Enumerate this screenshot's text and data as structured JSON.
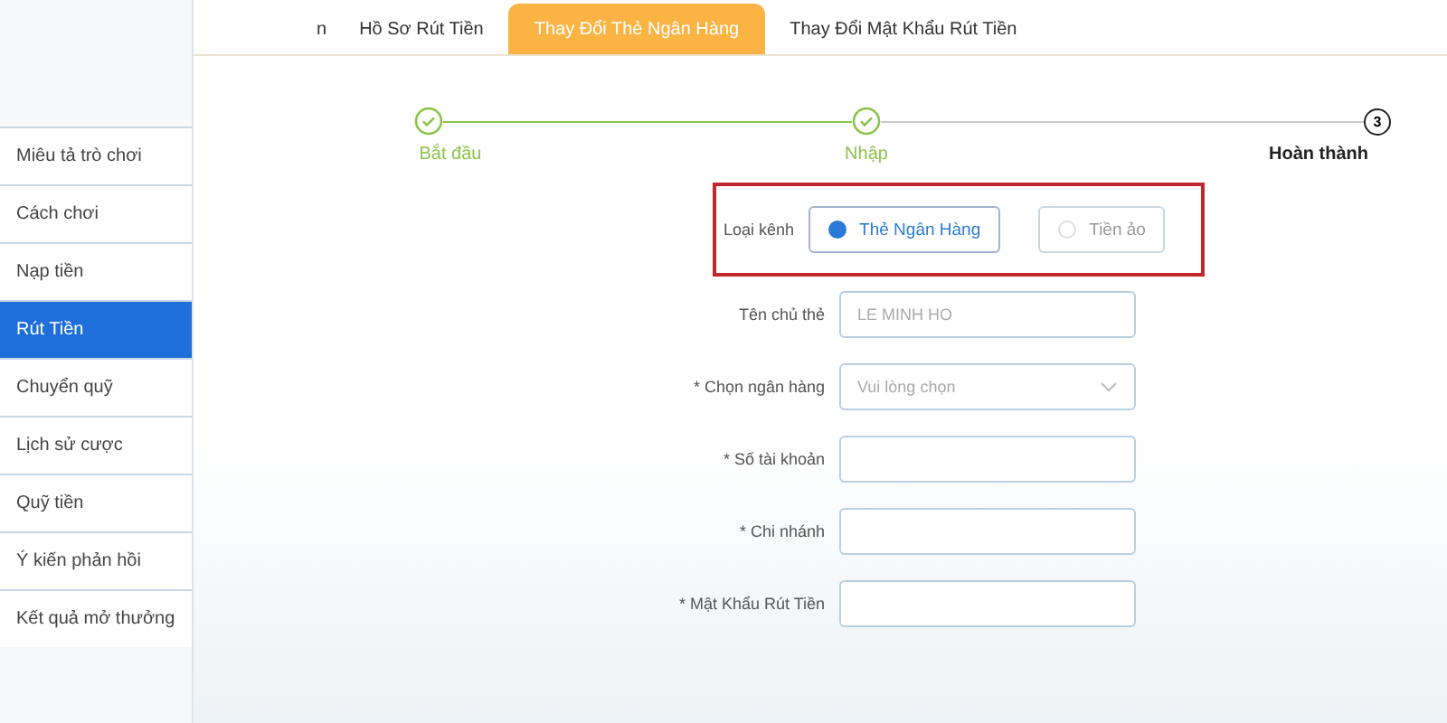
{
  "tabs": [
    {
      "label": "n",
      "selected": false
    },
    {
      "label": "Hồ Sơ Rút Tiền",
      "selected": false
    },
    {
      "label": "Thay Đổi Thẻ Ngân Hàng",
      "selected": true
    },
    {
      "label": "Thay Đổi Mật Khẩu Rút Tiền",
      "selected": false
    }
  ],
  "sidebar": {
    "items": [
      {
        "label": "Miêu tả trò chơi",
        "selected": false
      },
      {
        "label": "Cách chơi",
        "selected": false
      },
      {
        "label": "Nạp tiền",
        "selected": false
      },
      {
        "label": "Rút Tiền",
        "selected": true
      },
      {
        "label": "Chuyển quỹ",
        "selected": false
      },
      {
        "label": "Lịch sử cược",
        "selected": false
      },
      {
        "label": "Quỹ tiền",
        "selected": false
      },
      {
        "label": "Ý kiến phản hồi",
        "selected": false
      },
      {
        "label": "Kết quả mở thưởng",
        "selected": false
      }
    ]
  },
  "steps": [
    {
      "label": "Bắt đầu",
      "done": true
    },
    {
      "label": "Nhập",
      "done": true
    },
    {
      "label": "Hoàn thành",
      "done": false,
      "number": "3"
    }
  ],
  "form": {
    "channel": {
      "label": "Loại kênh",
      "highlighted": true,
      "options": [
        {
          "label": "Thẻ Ngân Hàng",
          "selected": true
        },
        {
          "label": "Tiền ảo",
          "selected": false
        }
      ]
    },
    "fields": [
      {
        "kind": "input",
        "label": "Tên chủ thẻ",
        "value": "LE MINH HO",
        "disabled": true
      },
      {
        "kind": "select",
        "label": "* Chọn ngân hàng",
        "placeholder": "Vui lòng chọn"
      },
      {
        "kind": "input",
        "label": "* Số tài khoản"
      },
      {
        "kind": "input",
        "label": "*  Chi nhánh"
      },
      {
        "kind": "input",
        "label": "* Mật Khẩu Rút Tiền"
      }
    ]
  }
}
